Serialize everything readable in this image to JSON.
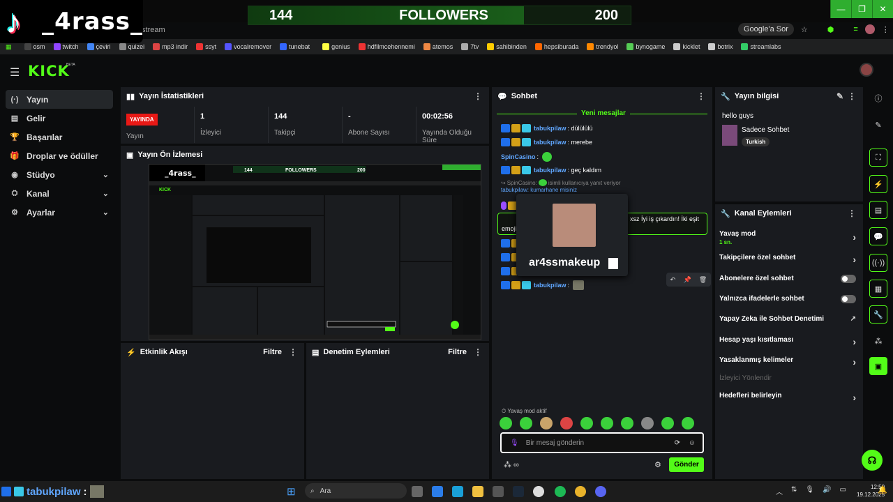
{
  "overlay": {
    "channel_name": "_4rass_",
    "followers_current": "144",
    "followers_label": "FOLLOWERS",
    "followers_goal": "200",
    "progress": 0.72
  },
  "browser": {
    "url_tail": "/stream",
    "google_btn": "Google'a Sor",
    "bookmarks": [
      "osm",
      "twitch",
      "çeviri",
      "quizei",
      "mp3 indir",
      "ssyt",
      "vocalremover",
      "tunebat",
      "genius",
      "hdfilmcehennemi",
      "atemos",
      "7tv",
      "sahibinden",
      "hepsiburada",
      "trendyol",
      "bynogame",
      "kicklet",
      "botrix",
      "streamlabs"
    ]
  },
  "app": {
    "logo": "KICK",
    "logo_beta": "BETA"
  },
  "sidebar": {
    "items": [
      {
        "label": "Yayın",
        "icon": "(·)"
      },
      {
        "label": "Gelir",
        "icon": "▤"
      },
      {
        "label": "Başarılar",
        "icon": "🏆"
      },
      {
        "label": "Droplar ve ödüller",
        "icon": "🎁"
      },
      {
        "label": "Stüdyo",
        "icon": "◉"
      },
      {
        "label": "Kanal",
        "icon": "⛭"
      },
      {
        "label": "Ayarlar",
        "icon": "⚙"
      }
    ]
  },
  "stats": {
    "title": "Yayın İstatistikleri",
    "live_badge": "YAYINDA",
    "live_label": "Yayın",
    "viewers_value": "1",
    "viewers_label": "İzleyici",
    "followers_value": "144",
    "followers_label": "Takipçi",
    "subs_value": "-",
    "subs_label": "Abone Sayısı",
    "duration_value": "00:02:56",
    "duration_label": "Yayında Olduğu Süre"
  },
  "preview": {
    "title": "Yayın Ön İzlemesi"
  },
  "activity": {
    "title": "Etkinlik Akışı",
    "filter": "Filtre"
  },
  "moderation": {
    "title": "Denetim Eylemleri",
    "filter": "Filtre"
  },
  "chat": {
    "title": "Sohbet",
    "new_messages": "Yeni mesajlar",
    "messages": [
      {
        "user": "tabukpilaw",
        "text": ": dülülülü"
      },
      {
        "user": "tabukpilaw",
        "text": ": merebe"
      },
      {
        "user": "SpinCasino",
        "text": ":"
      },
      {
        "user": "tabukpilaw",
        "text": ": geç kaldım"
      }
    ],
    "reply_user": "SpinCasino:",
    "reply_text": "isimli kullanıcıya yanıt veriyor",
    "reply_partial": "tabukpilaw: kumarhane misiniz",
    "highlight_text_a": "xsz İyi iş çıkardın! İki eşit",
    "highlight_text_b": "emojin",
    "last_user": "tabukpilaw",
    "slow_mode": "Yavaş mod aktif",
    "input_placeholder": "Bir mesaj gönderin",
    "send": "Gönder",
    "popup_name": "ar4ssmakeup"
  },
  "stream_info": {
    "title": "Yayın bilgisi",
    "stream_title": "hello guys",
    "category": "Sadece Sohbet",
    "language": "Turkish"
  },
  "channel_actions": {
    "title": "Kanal Eylemleri",
    "slow_mode": "Yavaş mod",
    "slow_mode_value": "1 sn.",
    "followers_only": "Takipçilere özel sohbet",
    "subs_only": "Abonelere özel sohbet",
    "emotes_only": "Yalnızca ifadelerle sohbet",
    "ai_moderation": "Yapay Zeka ile Sohbet Denetimi",
    "account_age": "Hesap yaşı kısıtlaması",
    "banned_words": "Yasaklanmış kelimeler",
    "redirect": "İzleyici Yönlendir",
    "goals": "Hedefleri belirleyin"
  },
  "taskbar": {
    "search": "Ara",
    "bottom_user": "tabukpilaw",
    "bottom_colon": ":",
    "time": "12:50",
    "date": "19.12.2025"
  },
  "colors": {
    "accent": "#53fc18",
    "live": "#e91916",
    "username": "#60a7ff"
  }
}
